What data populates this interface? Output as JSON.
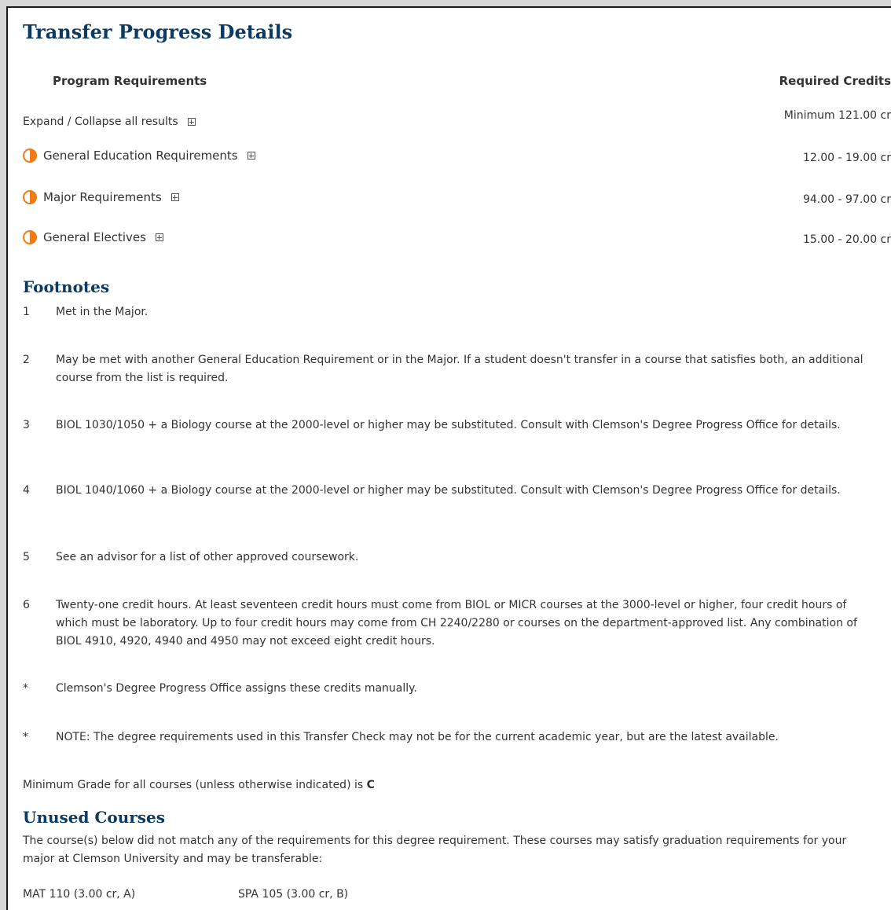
{
  "page": {
    "title": "Transfer Progress Details",
    "header": {
      "left": "Program Requirements",
      "right": "Required Credits"
    },
    "expand_all": "Expand / Collapse all results",
    "minimum_total": "Minimum 121.00 cr",
    "requirements": [
      {
        "label": "General Education Requirements",
        "credits": "12.00 - 19.00 cr",
        "status": "partial"
      },
      {
        "label": "Major Requirements",
        "credits": "94.00 - 97.00 cr",
        "status": "partial"
      },
      {
        "label": "General Electives",
        "credits": "15.00 - 20.00 cr",
        "status": "partial"
      }
    ],
    "icons": {
      "status": "half-circle-icon",
      "expand": "plus-box-icon"
    },
    "colors": {
      "heading": "#0b3b63",
      "status": "#f07a14"
    }
  },
  "footnotes": {
    "title": "Footnotes",
    "items": [
      {
        "num": "1",
        "text": "Met in the Major."
      },
      {
        "num": "2",
        "text": "May be met with another General Education Requirement or in the Major. If a student doesn't transfer in a course that satisfies both, an additional course from the list is required."
      },
      {
        "num": "3",
        "text": "BIOL 1030/1050 + a Biology course at the 2000-level or higher may be substituted. Consult with Clemson's Degree Progress Office for details."
      },
      {
        "num": "4",
        "text": "BIOL 1040/1060 + a Biology course at the 2000-level or higher may be substituted. Consult with Clemson's Degree Progress Office for details."
      },
      {
        "num": "5",
        "text": "See an advisor for a list of other approved coursework."
      },
      {
        "num": "6",
        "text": "Twenty-one credit hours. At least seventeen credit hours must come from BIOL or MICR courses at the 3000-level or higher, four credit hours of which must be laboratory. Up to four credit hours may come from CH 2240/2280 or courses on the department-approved list. Any combination of BIOL 4910, 4920, 4940 and 4950 may not exceed eight credit hours."
      },
      {
        "num": "*",
        "text": "Clemson's Degree Progress Office assigns these credits manually."
      },
      {
        "num": "*",
        "text": "NOTE: The degree requirements used in this Transfer Check may not be for the current academic year, but are the latest available."
      }
    ],
    "min_grade_prefix": "Minimum Grade for all courses (unless otherwise indicated) is ",
    "min_grade_value": "C"
  },
  "unused": {
    "title": "Unused Courses",
    "description": "The course(s) below did not match any of the requirements for this degree requirement. These courses may satisfy graduation requirements for your major at Clemson University and may be transferable:",
    "courses": [
      "MAT 110 (3.00 cr, A)",
      "SPA 105 (3.00 cr, B)"
    ]
  }
}
